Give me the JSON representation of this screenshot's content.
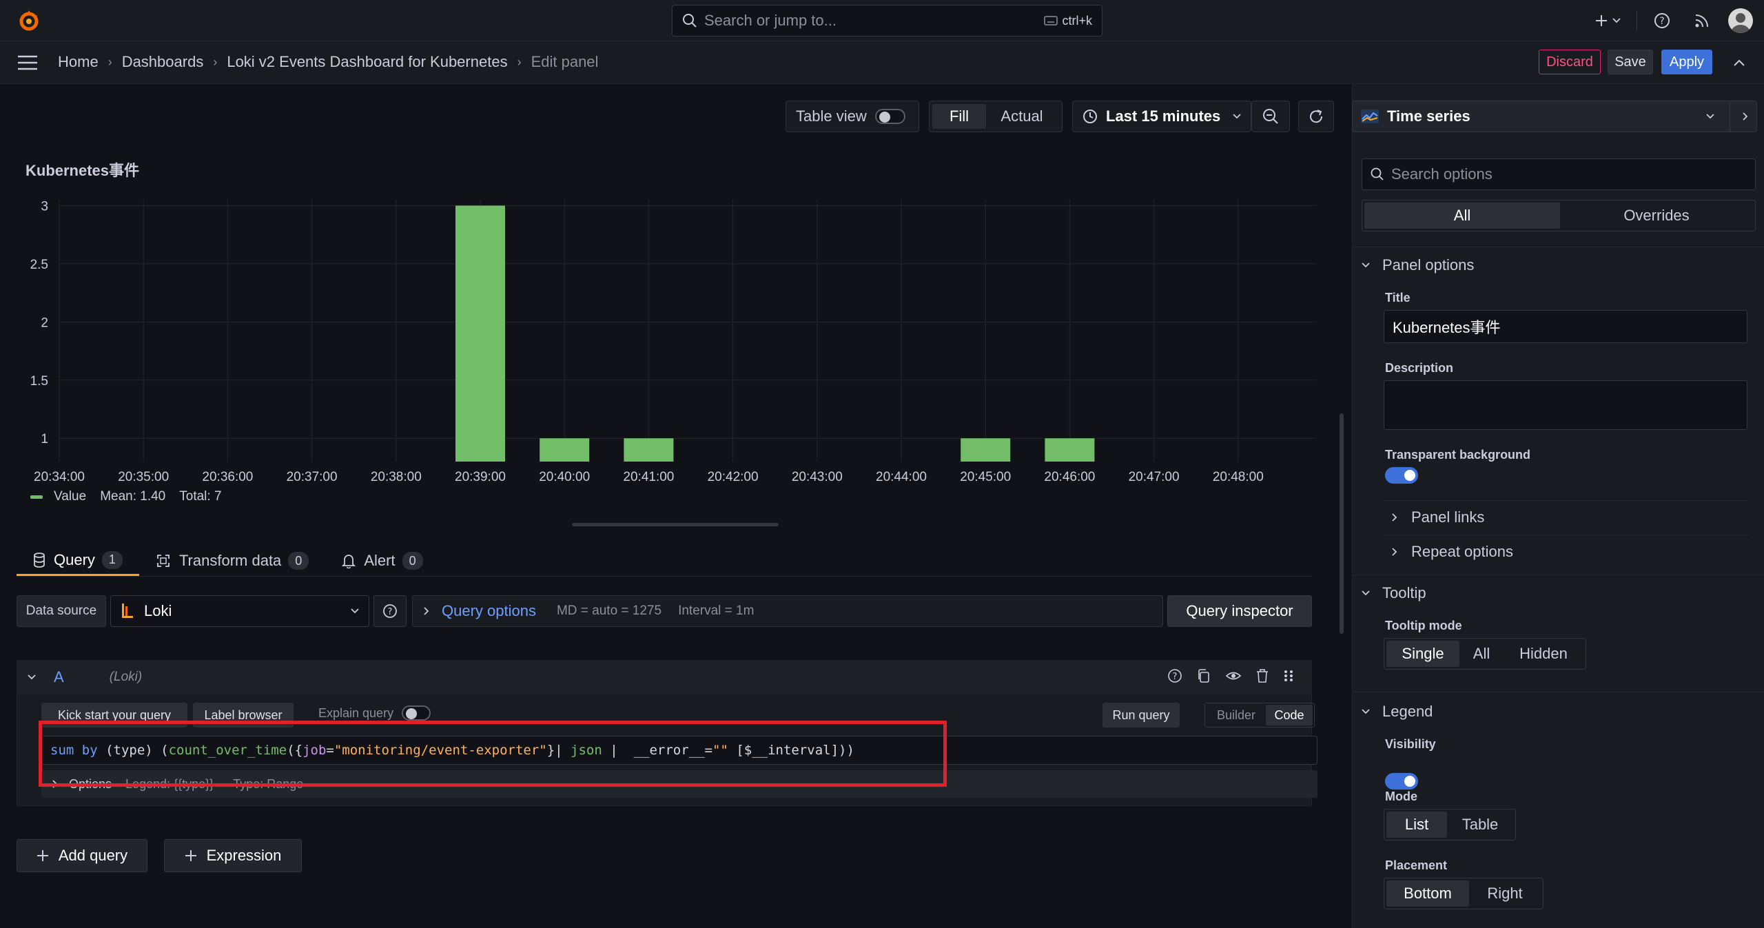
{
  "topbar": {
    "search_placeholder": "Search or jump to...",
    "search_shortcut": "ctrl+k"
  },
  "breadcrumb": {
    "items": [
      "Home",
      "Dashboards",
      "Loki v2 Events Dashboard for Kubernetes",
      "Edit panel"
    ]
  },
  "actions": {
    "discard": "Discard",
    "save": "Save",
    "apply": "Apply"
  },
  "toolbar": {
    "table_view": "Table view",
    "fill": "Fill",
    "actual": "Actual",
    "time_range": "Last 15 minutes"
  },
  "panel": {
    "title": "Kubernetes事件",
    "legend": {
      "name": "Value",
      "mean": "Mean: 1.40",
      "total": "Total: 7"
    },
    "series_color": "#73bf69"
  },
  "chart_data": {
    "type": "bar",
    "x": [
      "20:34:00",
      "20:35:00",
      "20:36:00",
      "20:37:00",
      "20:38:00",
      "20:39:00",
      "20:40:00",
      "20:41:00",
      "20:42:00",
      "20:43:00",
      "20:44:00",
      "20:45:00",
      "20:46:00",
      "20:47:00",
      "20:48:00"
    ],
    "series": [
      {
        "name": "Value",
        "values": [
          null,
          null,
          null,
          null,
          null,
          3,
          1,
          1,
          null,
          null,
          null,
          1,
          1,
          null,
          null
        ]
      }
    ],
    "yticks": [
      "3",
      "2.5",
      "2",
      "1.5",
      "1"
    ],
    "ylim": [
      0.8,
      3.05
    ],
    "grid": true,
    "legend_placement": "bottom-left"
  },
  "tabs": [
    {
      "label": "Query",
      "count": "1"
    },
    {
      "label": "Transform data",
      "count": "0"
    },
    {
      "label": "Alert",
      "count": "0"
    }
  ],
  "datasource": {
    "label": "Data source",
    "value": "Loki",
    "query_options": "Query options",
    "md": "MD = auto = 1275",
    "interval": "Interval = 1m",
    "inspector": "Query inspector"
  },
  "query": {
    "ref": "A",
    "ds": "(Loki)",
    "kick_start": "Kick start your query",
    "label_browser": "Label browser",
    "explain": "Explain query",
    "run": "Run query",
    "builder": "Builder",
    "code": "Code",
    "expr": {
      "p1": "sum by",
      "p2": " (type) (",
      "p3": "count_over_time",
      "p4": "({",
      "p5": "job",
      "p6": "=",
      "p7": "\"monitoring/event-exporter\"",
      "p8": "}| ",
      "p9": "json",
      "p10": " |  ",
      "p11": "__error__",
      "p12": "=",
      "p13": "\"\"",
      "p14": " [$__interval]))"
    },
    "options_label": "Options",
    "options_legend": "Legend: {{type}}",
    "options_type": "Type: Range"
  },
  "add": {
    "query": "Add query",
    "expression": "Expression"
  },
  "options_pane": {
    "viz": "Time series",
    "search_placeholder": "Search options",
    "all": "All",
    "overrides": "Overrides",
    "panel_options": "Panel options",
    "title_label": "Title",
    "title_value": "Kubernetes事件",
    "description_label": "Description",
    "transparent_label": "Transparent background",
    "panel_links": "Panel links",
    "repeat_options": "Repeat options",
    "tooltip": "Tooltip",
    "tooltip_mode": "Tooltip mode",
    "tooltip_modes": [
      "Single",
      "All",
      "Hidden"
    ],
    "legend": "Legend",
    "visibility": "Visibility",
    "mode": "Mode",
    "modes": [
      "List",
      "Table"
    ],
    "placement": "Placement",
    "placements": [
      "Bottom",
      "Right"
    ]
  }
}
